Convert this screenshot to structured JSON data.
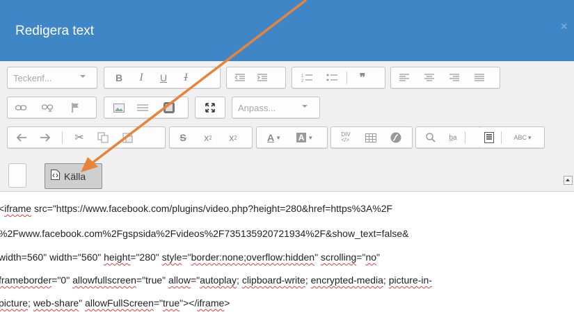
{
  "dialog": {
    "title": "Redigera text",
    "close_glyph": "×"
  },
  "toolbar": {
    "font_combo": "Teckenf...",
    "format_combo": "Anpass...",
    "source_label": "Källa",
    "icons_row1": [
      "bold-icon",
      "italic-icon",
      "underline-icon",
      "remove-format-icon",
      "outdent-icon",
      "indent-icon",
      "numbered-list-icon",
      "bullet-list-icon",
      "blockquote-icon",
      "align-left-icon",
      "align-center-icon",
      "align-right-icon",
      "justify-icon"
    ],
    "icons_row2": [
      "link-icon",
      "unlink-icon",
      "anchor-icon",
      "image-icon",
      "horizontal-rule-icon",
      "iframe-icon",
      "maximize-icon"
    ],
    "icons_row3": [
      "undo-icon",
      "redo-icon",
      "cut-icon",
      "copy-icon",
      "paste-icon",
      "strike-icon",
      "subscript-icon",
      "superscript-icon",
      "text-color-icon",
      "bg-color-icon",
      "div-icon",
      "table-icon",
      "flash-icon",
      "find-icon",
      "replace-icon",
      "template-icon",
      "spellcheck-icon"
    ]
  },
  "source": {
    "line1": {
      "a": "iframe",
      "b": " src=\"https://www.facebook.com/plugins/video.php?height=280&href=https%3A%2F"
    },
    "line2": {
      "a": "%2Fwww.facebook.com%2Fgspsida%2Fvideos%2F735135920721934%2F&show_text=false&"
    },
    "line3": {
      "a": "width=560\" width=\"560\" ",
      "b": "height",
      "c": "=\"280\" ",
      "d": "style",
      "e": "=\"",
      "f": "border:none;overflow:hidden",
      "g": "\" ",
      "h": "scrolling",
      "i": "=\"",
      "j": "no",
      "k": "\""
    },
    "line4": {
      "a": "frameborder",
      "b": "=\"0\" ",
      "c": "allowfullscreen",
      "d": "=\"true\" ",
      "e": "allow",
      "f": "=\"",
      "g": "autoplay",
      "h": "; ",
      "i": "clipboard-write",
      "j": "; ",
      "k": "encrypted-media",
      "l": "; ",
      "m": "picture-in-"
    },
    "line5": {
      "a": "picture",
      "b": "; ",
      "c": "web-share",
      "d": "\" ",
      "e": "allowFullScreen",
      "f": "=\"",
      "g": "true",
      "h": "\"></",
      "i": "iframe",
      "j": ">"
    }
  },
  "colors": {
    "titlebar": "#3f86c7",
    "arrow": "#e8843a"
  }
}
